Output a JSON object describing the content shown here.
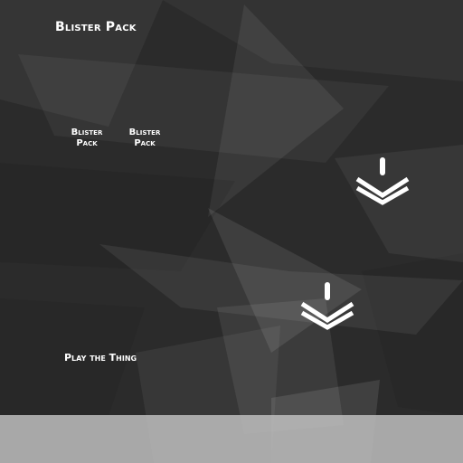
{
  "header": {
    "title": "Blister Pack"
  },
  "packs": [
    {
      "label_line1": "Blister",
      "label_line2": "Pack"
    },
    {
      "label_line1": "Blister",
      "label_line2": "Pack"
    }
  ],
  "actions": {
    "play_label": "Play the Thing"
  },
  "icons": {
    "logo": "blister-pack-logo-icon"
  },
  "colors": {
    "background": "#2a2a2a",
    "text": "#ffffff",
    "bottom_bar": "#bebebe"
  }
}
